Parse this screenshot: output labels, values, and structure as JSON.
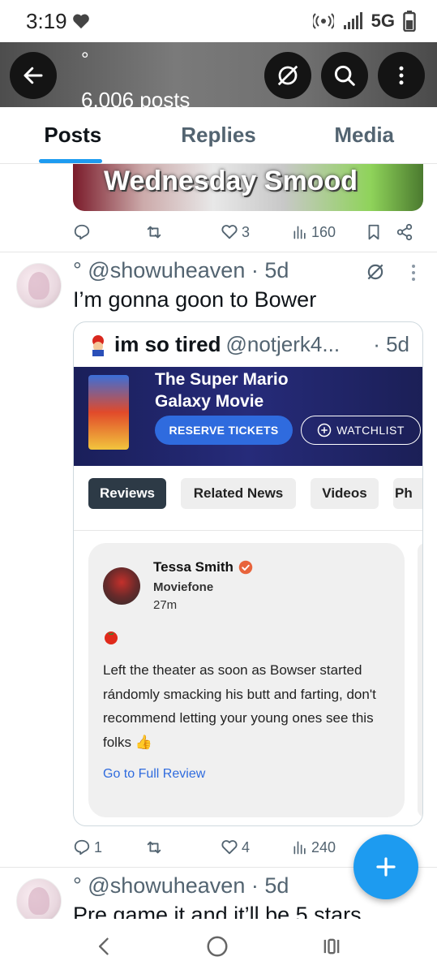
{
  "status_bar": {
    "time": "3:19",
    "network": "5G"
  },
  "header": {
    "name_fragment": "°",
    "posts_count": "6,006 posts"
  },
  "tabs": [
    {
      "label": "Posts",
      "active": true
    },
    {
      "label": "Replies",
      "active": false
    },
    {
      "label": "Media",
      "active": false
    }
  ],
  "previous_post": {
    "media_text": "Wednesday Smood",
    "likes": "3",
    "views": "160"
  },
  "post": {
    "handle_line": "° @showuheaven · 5d",
    "text": "I’m gonna goon to Bower",
    "quote": {
      "name": "im so tired",
      "handle": "@notjerk4...",
      "time": "· 5d",
      "movie_title": "The Super Mario Galaxy Movie",
      "reserve_label": "RESERVE TICKETS",
      "watchlist_label": "WATCHLIST",
      "chips": [
        "Reviews",
        "Related News",
        "Videos",
        "Ph"
      ],
      "review": {
        "author": "Tessa Smith",
        "source": "Moviefone",
        "time": "27m",
        "body": "Left the theater as soon as Bowser started rándomly smacking his butt and farting, don't recommend letting your young ones see this folks 👍",
        "link": "Go to Full Review"
      }
    },
    "replies": "1",
    "likes": "4",
    "views": "240"
  },
  "next_post": {
    "handle_line": "° @showuheaven · 5d",
    "text": "Pre game it and it’ll be 5 stars"
  },
  "colors": {
    "accent": "#1d9bf0",
    "text_secondary": "#536471",
    "review_link": "#2f6bde"
  }
}
